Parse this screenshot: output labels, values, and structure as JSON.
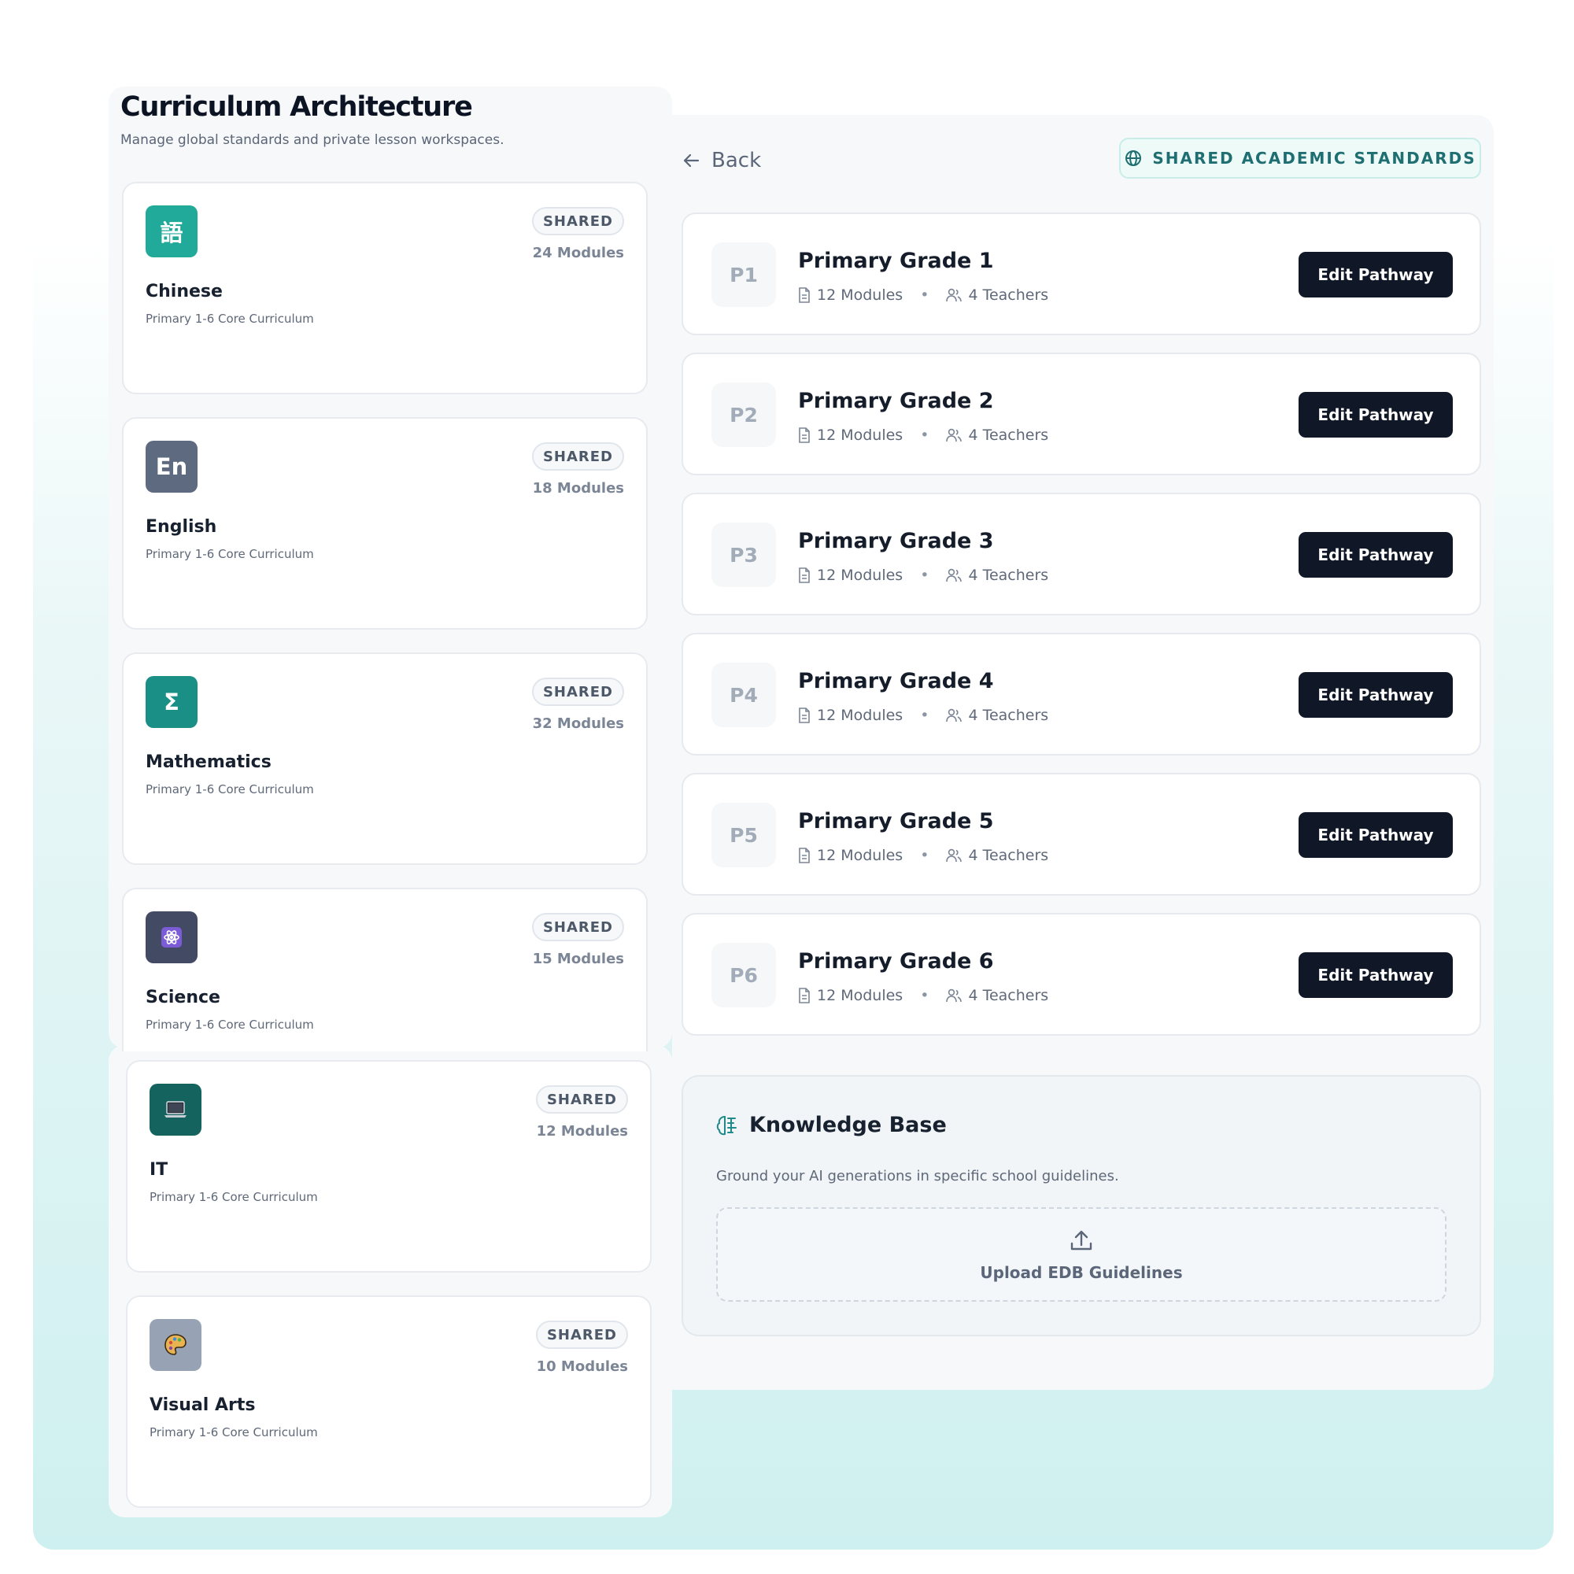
{
  "header": {
    "title": "Curriculum Architecture",
    "subtitle": "Manage global standards and private lesson workspaces."
  },
  "subjects": [
    {
      "name": "Chinese",
      "icon_text": "語",
      "icon": "chinese-character-icon",
      "color": "#21a99a",
      "badge": "SHARED",
      "modules": "24 Modules",
      "desc": "Primary 1-6 Core Curriculum"
    },
    {
      "name": "English",
      "icon_text": "En",
      "icon": "english-letters-icon",
      "color": "#5e6a80",
      "badge": "SHARED",
      "modules": "18 Modules",
      "desc": "Primary 1-6 Core Curriculum"
    },
    {
      "name": "Mathematics",
      "icon_text": "Σ",
      "icon": "sigma-icon",
      "color": "#1a8f85",
      "badge": "SHARED",
      "modules": "32 Modules",
      "desc": "Primary 1-6 Core Curriculum"
    },
    {
      "name": "Science",
      "icon_text": "⚛",
      "icon": "atom-icon",
      "color": "#434a64",
      "badge": "SHARED",
      "modules": "15 Modules",
      "desc": "Primary 1-6 Core Curriculum"
    },
    {
      "name": "IT",
      "icon_text": "💻",
      "icon": "laptop-icon",
      "color": "#15635e",
      "badge": "SHARED",
      "modules": "12 Modules",
      "desc": "Primary 1-6 Core Curriculum"
    },
    {
      "name": "Visual Arts",
      "icon_text": "🎨",
      "icon": "palette-icon",
      "color": "#97a2b4",
      "badge": "SHARED",
      "modules": "10 Modules",
      "desc": "Primary 1-6 Core Curriculum"
    }
  ],
  "nav": {
    "back_label": "Back",
    "standards_label": "SHARED ACADEMIC STANDARDS"
  },
  "grades": [
    {
      "tag": "P1",
      "title": "Primary Grade 1",
      "modules": "12 Modules",
      "teachers": "4 Teachers",
      "button": "Edit Pathway"
    },
    {
      "tag": "P2",
      "title": "Primary Grade 2",
      "modules": "12 Modules",
      "teachers": "4 Teachers",
      "button": "Edit Pathway"
    },
    {
      "tag": "P3",
      "title": "Primary Grade 3",
      "modules": "12 Modules",
      "teachers": "4 Teachers",
      "button": "Edit Pathway"
    },
    {
      "tag": "P4",
      "title": "Primary Grade 4",
      "modules": "12 Modules",
      "teachers": "4 Teachers",
      "button": "Edit Pathway"
    },
    {
      "tag": "P5",
      "title": "Primary Grade 5",
      "modules": "12 Modules",
      "teachers": "4 Teachers",
      "button": "Edit Pathway"
    },
    {
      "tag": "P6",
      "title": "Primary Grade 6",
      "modules": "12 Modules",
      "teachers": "4 Teachers",
      "button": "Edit Pathway"
    }
  ],
  "knowledge_base": {
    "title": "Knowledge Base",
    "description": "Ground your AI generations in specific school guidelines.",
    "upload_label": "Upload EDB Guidelines"
  },
  "colors": {
    "accent": "#1f6f72",
    "primary_button": "#101827"
  }
}
